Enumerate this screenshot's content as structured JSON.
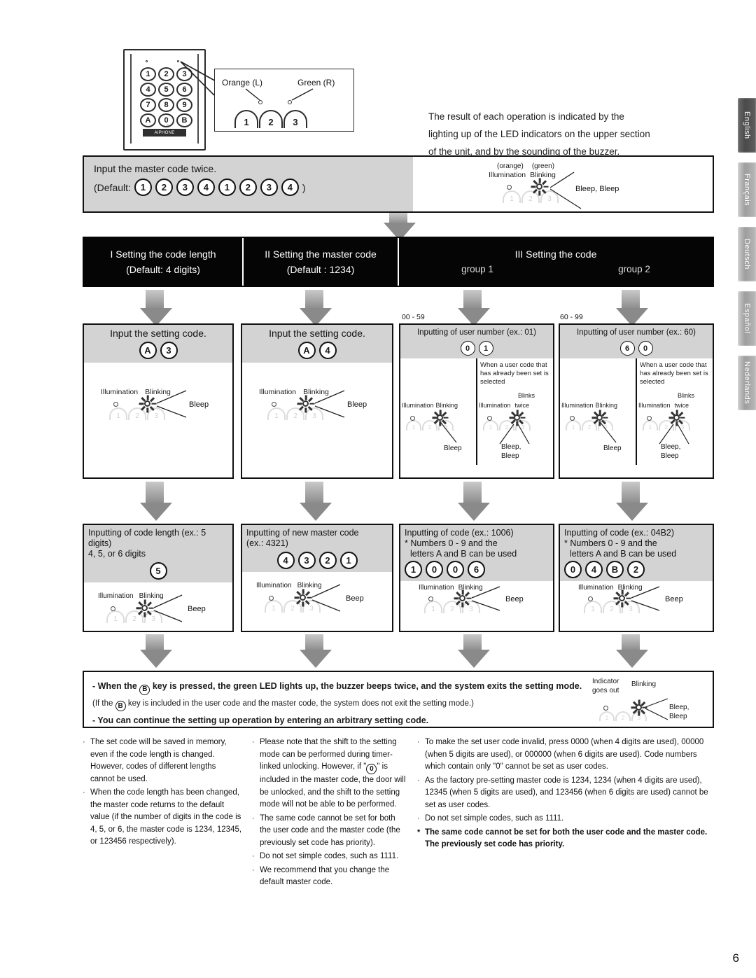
{
  "page_number": "6",
  "language_tabs": [
    {
      "label": "English",
      "active": true
    },
    {
      "label": "Français",
      "active": false
    },
    {
      "label": "Deutsch",
      "active": false
    },
    {
      "label": "Español",
      "active": false
    },
    {
      "label": "Nederlands",
      "active": false
    }
  ],
  "device": {
    "keys": [
      "1",
      "2",
      "3",
      "4",
      "5",
      "6",
      "7",
      "8",
      "9",
      "A",
      "0",
      "B"
    ],
    "brand": "AIPHONE",
    "callout": {
      "orange_label": "Orange (L)",
      "green_label": "Green (R)",
      "arc_digits": [
        "1",
        "2",
        "3"
      ]
    }
  },
  "intro": {
    "line1": "The result of each operation is indicated by the",
    "line2": "lighting up of the LED indicators on the upper section",
    "line3": "of the unit, and by the sounding of the buzzer."
  },
  "master_step": {
    "title": "Input the master code twice.",
    "default_prefix": "(Default:",
    "default_suffix": ")",
    "keys": [
      "1",
      "2",
      "3",
      "4",
      "1",
      "2",
      "3",
      "4"
    ],
    "led": {
      "orange_paren": "(orange)",
      "green_paren": "(green)",
      "illumination": "Illumination",
      "blinking": "Blinking",
      "beep": "Bleep, Bleep"
    }
  },
  "section_bar": {
    "col1_line1": "I Setting the code length",
    "col1_line2": "(Default: 4 digits)",
    "col2_line1": "II Setting the master code",
    "col2_line2": "(Default : 1234)",
    "col3_line1": "III Setting the code",
    "group1": "group 1",
    "group2": "group 2"
  },
  "row2": {
    "col1": {
      "title": "Input the setting code.",
      "keys": [
        "A",
        "3"
      ],
      "illumination": "Illumination",
      "blinking": "Blinking",
      "beep": "Bleep"
    },
    "col2": {
      "title": "Input the setting code.",
      "keys": [
        "A",
        "4"
      ],
      "illumination": "Illumination",
      "blinking": "Blinking",
      "beep": "Bleep"
    },
    "group1": {
      "range": "00 - 59",
      "title": "Inputting of user number (ex.:  01)",
      "keys": [
        "0",
        "1"
      ],
      "left": {
        "illumination": "Illumination",
        "blinking": "Blinking",
        "beep": "Bleep"
      },
      "right": {
        "note": "When a user code that has already been set is selected",
        "illumination": "Illumination",
        "blinking": "Blinks twice",
        "beep": "Bleep,\nBleep"
      }
    },
    "group2": {
      "range": "60 - 99",
      "title": "Inputting of user number (ex.:  60)",
      "keys": [
        "6",
        "0"
      ],
      "left": {
        "illumination": "Illumination",
        "blinking": "Blinking",
        "beep": "Bleep"
      },
      "right": {
        "note": "When a user code that has already been set is selected",
        "illumination": "Illumination",
        "blinking": "Blinks twice",
        "beep": "Bleep,\nBleep"
      }
    }
  },
  "row3": {
    "col1": {
      "title_line1": "Inputting of code length (ex.:  5 digits)",
      "title_line2": "4, 5, or 6 digits",
      "keys": [
        "5"
      ],
      "illumination": "Illumination",
      "blinking": "Blinking",
      "beep": "Beep"
    },
    "col2": {
      "title_line1": "Inputting of new master code",
      "title_line2": "(ex.:  4321)",
      "keys": [
        "4",
        "3",
        "2",
        "1"
      ],
      "illumination": "Illumination",
      "blinking": "Blinking",
      "beep": "Beep"
    },
    "group1": {
      "title_line1": "Inputting of code (ex.:  1006)",
      "title_line2": "* Numbers 0 - 9 and the",
      "title_line3": "letters A and B can be used",
      "keys": [
        "1",
        "0",
        "0",
        "6"
      ],
      "illumination": "Illumination",
      "blinking": "Blinking",
      "beep": "Beep"
    },
    "group2": {
      "title_line1": "Inputting of code (ex.:  04B2)",
      "title_line2": "* Numbers 0 - 9 and the",
      "title_line3": "letters A and B can be used",
      "keys": [
        "0",
        "4",
        "B",
        "2"
      ],
      "illumination": "Illumination",
      "blinking": "Blinking",
      "beep": "Beep"
    }
  },
  "note_box": {
    "line1_a": "- When the",
    "line1_key": "B",
    "line1_b": "key is pressed, the green LED lights up, the buzzer beeps twice, and the system exits the setting mode.",
    "line2_a": "(If the",
    "line2_key": "B",
    "line2_b": "key is included in the user code and the master code, the system does not exit the setting mode.)",
    "line3": "- You can continue the setting up operation by entering an arbitrary setting code.",
    "indicator_label_line1": "Indicator",
    "indicator_label_line2": "goes out",
    "blinking": "Blinking",
    "beep": "Bleep,\nBleep"
  },
  "footnotes": {
    "col1": [
      "The set code will be saved in memory, even if the code length is changed. However, codes of different lengths cannot be used.",
      "When the code length has been changed, the master code returns to the default value (if the number of digits in the code is 4, 5, or 6, the master code is 1234, 12345, or 123456 respectively)."
    ],
    "col2_item1_a": "Please note that the shift to the setting mode can be performed during timer-linked unlocking. However, if \"",
    "col2_item1_key": "0",
    "col2_item1_b": "\" is included in the master code, the door will be unlocked, and the shift to the setting mode will not be able to be performed.",
    "col2_rest": [
      "The same code cannot be set for both the user code and the master code (the previously set code has priority).",
      "Do not set simple codes, such as 1111.",
      "We recommend that you change the default master code."
    ],
    "col3": [
      "To make the set user code invalid, press 0000 (when 4 digits are used), 00000 (when 5 digits are used), or 000000 (when 6 digits are used). Code numbers which contain only \"0\" cannot be set as user codes.",
      "As the factory pre-setting master code is 1234, 1234 (when 4 digits are used), 12345 (when 5 digits are used), and 123456 (when 6 digits are used) cannot be set as user codes.",
      "Do not set simple codes, such as 1111."
    ],
    "col3_star": "The same code cannot be set for both the user code and the master code. The previously set code has priority."
  }
}
